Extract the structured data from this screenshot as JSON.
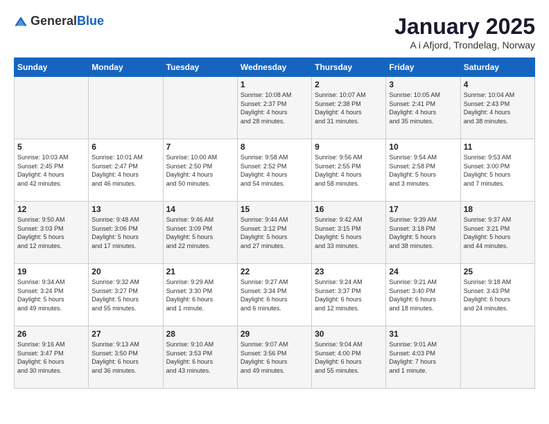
{
  "logo": {
    "general": "General",
    "blue": "Blue"
  },
  "title": "January 2025",
  "subtitle": "A i Afjord, Trondelag, Norway",
  "headers": [
    "Sunday",
    "Monday",
    "Tuesday",
    "Wednesday",
    "Thursday",
    "Friday",
    "Saturday"
  ],
  "weeks": [
    [
      {
        "day": "",
        "info": ""
      },
      {
        "day": "",
        "info": ""
      },
      {
        "day": "",
        "info": ""
      },
      {
        "day": "1",
        "info": "Sunrise: 10:08 AM\nSunset: 2:37 PM\nDaylight: 4 hours\nand 28 minutes."
      },
      {
        "day": "2",
        "info": "Sunrise: 10:07 AM\nSunset: 2:38 PM\nDaylight: 4 hours\nand 31 minutes."
      },
      {
        "day": "3",
        "info": "Sunrise: 10:05 AM\nSunset: 2:41 PM\nDaylight: 4 hours\nand 35 minutes."
      },
      {
        "day": "4",
        "info": "Sunrise: 10:04 AM\nSunset: 2:43 PM\nDaylight: 4 hours\nand 38 minutes."
      }
    ],
    [
      {
        "day": "5",
        "info": "Sunrise: 10:03 AM\nSunset: 2:45 PM\nDaylight: 4 hours\nand 42 minutes."
      },
      {
        "day": "6",
        "info": "Sunrise: 10:01 AM\nSunset: 2:47 PM\nDaylight: 4 hours\nand 46 minutes."
      },
      {
        "day": "7",
        "info": "Sunrise: 10:00 AM\nSunset: 2:50 PM\nDaylight: 4 hours\nand 50 minutes."
      },
      {
        "day": "8",
        "info": "Sunrise: 9:58 AM\nSunset: 2:52 PM\nDaylight: 4 hours\nand 54 minutes."
      },
      {
        "day": "9",
        "info": "Sunrise: 9:56 AM\nSunset: 2:55 PM\nDaylight: 4 hours\nand 58 minutes."
      },
      {
        "day": "10",
        "info": "Sunrise: 9:54 AM\nSunset: 2:58 PM\nDaylight: 5 hours\nand 3 minutes."
      },
      {
        "day": "11",
        "info": "Sunrise: 9:53 AM\nSunset: 3:00 PM\nDaylight: 5 hours\nand 7 minutes."
      }
    ],
    [
      {
        "day": "12",
        "info": "Sunrise: 9:50 AM\nSunset: 3:03 PM\nDaylight: 5 hours\nand 12 minutes."
      },
      {
        "day": "13",
        "info": "Sunrise: 9:48 AM\nSunset: 3:06 PM\nDaylight: 5 hours\nand 17 minutes."
      },
      {
        "day": "14",
        "info": "Sunrise: 9:46 AM\nSunset: 3:09 PM\nDaylight: 5 hours\nand 22 minutes."
      },
      {
        "day": "15",
        "info": "Sunrise: 9:44 AM\nSunset: 3:12 PM\nDaylight: 5 hours\nand 27 minutes."
      },
      {
        "day": "16",
        "info": "Sunrise: 9:42 AM\nSunset: 3:15 PM\nDaylight: 5 hours\nand 33 minutes."
      },
      {
        "day": "17",
        "info": "Sunrise: 9:39 AM\nSunset: 3:18 PM\nDaylight: 5 hours\nand 38 minutes."
      },
      {
        "day": "18",
        "info": "Sunrise: 9:37 AM\nSunset: 3:21 PM\nDaylight: 5 hours\nand 44 minutes."
      }
    ],
    [
      {
        "day": "19",
        "info": "Sunrise: 9:34 AM\nSunset: 3:24 PM\nDaylight: 5 hours\nand 49 minutes."
      },
      {
        "day": "20",
        "info": "Sunrise: 9:32 AM\nSunset: 3:27 PM\nDaylight: 5 hours\nand 55 minutes."
      },
      {
        "day": "21",
        "info": "Sunrise: 9:29 AM\nSunset: 3:30 PM\nDaylight: 6 hours\nand 1 minute."
      },
      {
        "day": "22",
        "info": "Sunrise: 9:27 AM\nSunset: 3:34 PM\nDaylight: 6 hours\nand 6 minutes."
      },
      {
        "day": "23",
        "info": "Sunrise: 9:24 AM\nSunset: 3:37 PM\nDaylight: 6 hours\nand 12 minutes."
      },
      {
        "day": "24",
        "info": "Sunrise: 9:21 AM\nSunset: 3:40 PM\nDaylight: 6 hours\nand 18 minutes."
      },
      {
        "day": "25",
        "info": "Sunrise: 9:18 AM\nSunset: 3:43 PM\nDaylight: 6 hours\nand 24 minutes."
      }
    ],
    [
      {
        "day": "26",
        "info": "Sunrise: 9:16 AM\nSunset: 3:47 PM\nDaylight: 6 hours\nand 30 minutes."
      },
      {
        "day": "27",
        "info": "Sunrise: 9:13 AM\nSunset: 3:50 PM\nDaylight: 6 hours\nand 36 minutes."
      },
      {
        "day": "28",
        "info": "Sunrise: 9:10 AM\nSunset: 3:53 PM\nDaylight: 6 hours\nand 43 minutes."
      },
      {
        "day": "29",
        "info": "Sunrise: 9:07 AM\nSunset: 3:56 PM\nDaylight: 6 hours\nand 49 minutes."
      },
      {
        "day": "30",
        "info": "Sunrise: 9:04 AM\nSunset: 4:00 PM\nDaylight: 6 hours\nand 55 minutes."
      },
      {
        "day": "31",
        "info": "Sunrise: 9:01 AM\nSunset: 4:03 PM\nDaylight: 7 hours\nand 1 minute."
      },
      {
        "day": "",
        "info": ""
      }
    ]
  ]
}
